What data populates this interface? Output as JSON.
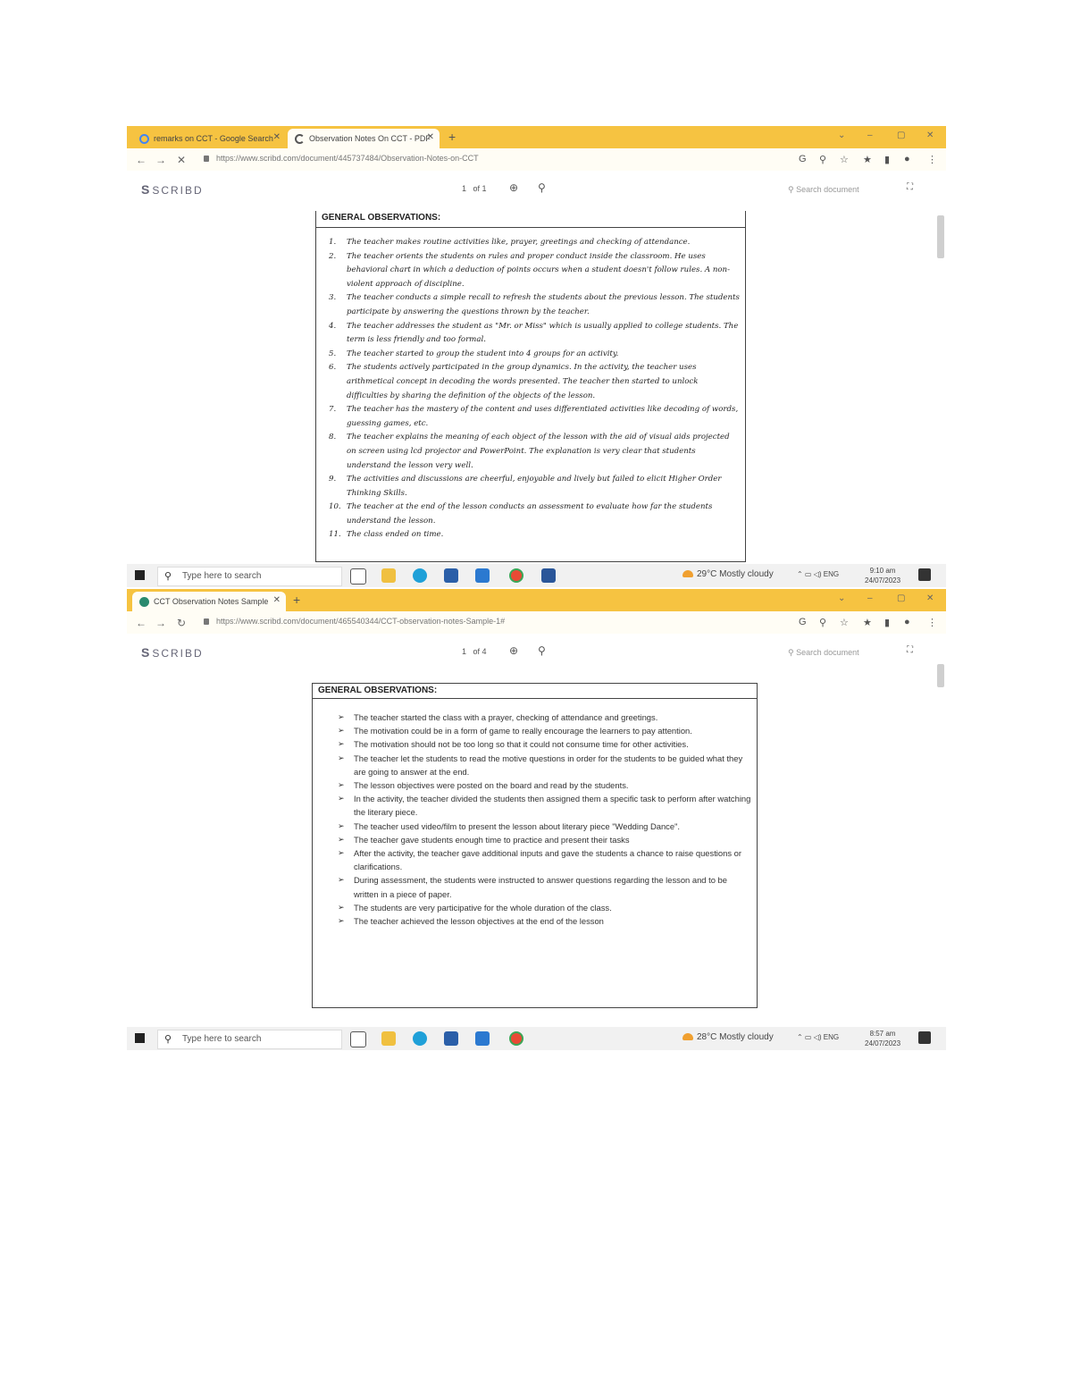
{
  "screenshot1": {
    "tabs": [
      {
        "label": "remarks on CCT - Google Search",
        "icon": "google-icon"
      },
      {
        "label": "Observation Notes On CCT - PDF",
        "icon": "loading-icon"
      }
    ],
    "url": "https://www.scribd.com/document/445737484/Observation-Notes-on-CCT",
    "logo_text": "SCRIBD",
    "page_current": "1",
    "page_total": "of 1",
    "search_placeholder": "Search document",
    "doc_title": "GENERAL OBSERVATIONS:",
    "items": [
      {
        "num": "1.",
        "text": "The teacher makes routine activities like, prayer, greetings and checking of attendance."
      },
      {
        "num": "2.",
        "text": "The teacher orients the students on rules and proper conduct inside the classroom. He uses behavioral chart in which a deduction of points occurs when a student doesn't follow rules. A non-violent approach of discipline."
      },
      {
        "num": "3.",
        "text": "The teacher conducts a simple recall to refresh the students about the previous lesson. The students participate by answering the questions thrown by the teacher."
      },
      {
        "num": "4.",
        "text": "The teacher addresses the student as \"Mr. or Miss\" which is usually applied to college students. The term is less friendly and too formal."
      },
      {
        "num": "5.",
        "text": "The teacher started to group the student into 4 groups for an activity."
      },
      {
        "num": "6.",
        "text": "The students actively participated in the group dynamics. In the activity, the teacher uses arithmetical concept in decoding the words presented. The teacher then started to unlock difficulties by sharing the definition of the objects of the lesson."
      },
      {
        "num": "7.",
        "text": "The teacher has the mastery of the content and uses differentiated activities like decoding of words, guessing games, etc."
      },
      {
        "num": "8.",
        "text": "The teacher explains the meaning of each object of the lesson with the aid of visual aids projected on screen using lcd projector and PowerPoint. The explanation is very clear that students understand the lesson very well."
      },
      {
        "num": "9.",
        "text": "The activities and discussions are cheerful, enjoyable and lively but failed to elicit Higher Order Thinking Skills."
      },
      {
        "num": "10.",
        "text": "The teacher at the end of the lesson conducts an assessment to evaluate how far the students understand the lesson."
      },
      {
        "num": "11.",
        "text": "The class ended on time."
      }
    ],
    "taskbar": {
      "search_placeholder": "Type here to search",
      "weather": "29°C Mostly cloudy",
      "lang": "ENG",
      "time": "9:10 am",
      "date": "24/07/2023"
    }
  },
  "screenshot2": {
    "tabs": [
      {
        "label": "CCT Observation Notes Sample",
        "icon": "scribd-icon"
      }
    ],
    "url": "https://www.scribd.com/document/465540344/CCT-observation-notes-Sample-1#",
    "logo_text": "SCRIBD",
    "page_current": "1",
    "page_total": "of 4",
    "search_placeholder": "Search document",
    "doc_title": "GENERAL OBSERVATIONS:",
    "bullets": [
      "The teacher started the class with a prayer, checking of attendance and greetings.",
      "The motivation could be in a form of game to really encourage the learners to pay attention.",
      "The motivation should not be too long so that it could not consume time for other activities.",
      "The teacher let the students to read the motive questions in order for the students to be guided what they are going to answer at the end.",
      "The lesson objectives were posted on the board and read by the students.",
      "In the activity, the teacher divided the students then assigned them a specific task to perform after watching the literary piece.",
      "The teacher used video/film to present the lesson about literary piece \"Wedding Dance\".",
      "The teacher gave students enough time to practice and present their tasks",
      "After the activity, the teacher gave additional inputs and gave the students a chance to raise questions or clarifications.",
      "During assessment, the students were instructed to answer questions regarding the lesson and to be written in a piece of paper.",
      "The students are very participative for the whole duration of the class.",
      "The teacher achieved the lesson objectives at the end of the lesson"
    ],
    "taskbar": {
      "search_placeholder": "Type here to search",
      "weather": "28°C Mostly cloudy",
      "lang": "ENG",
      "time": "8:57 am",
      "date": "24/07/2023"
    }
  },
  "colors": {
    "tabbar": "#f6c341",
    "taskbar": "#f1f1f1",
    "doc_border": "#444444"
  }
}
